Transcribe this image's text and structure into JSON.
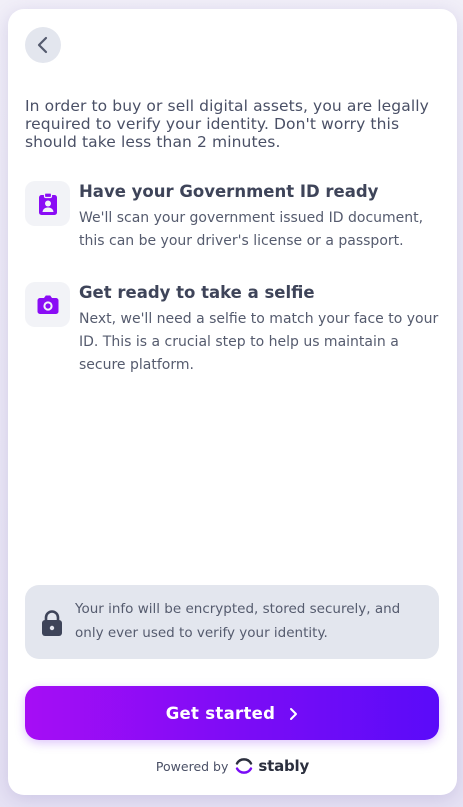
{
  "intro_text": "In order to buy or sell digital assets, you are legally required to verify your identity. Don't worry this should take less than 2 minutes.",
  "steps": [
    {
      "title": "Have your Government ID ready",
      "description": "We'll scan your government issued ID document, this can be your driver's license or a passport.",
      "icon": "id-badge-icon"
    },
    {
      "title": "Get ready to take a selfie",
      "description": "Next, we'll need a selfie to match your face to your ID. This is a crucial step to help us maintain a secure platform.",
      "icon": "camera-icon"
    }
  ],
  "info_notice": "Your info will be encrypted, stored securely, and only ever used to verify your identity.",
  "cta_label": "Get started",
  "footer": {
    "powered_by": "Powered by",
    "brand": "stably"
  },
  "colors": {
    "accent": "#8a0cf5",
    "accent_end": "#5a0bf9",
    "text": "#4a5066",
    "panel": "#e3e6ee"
  }
}
